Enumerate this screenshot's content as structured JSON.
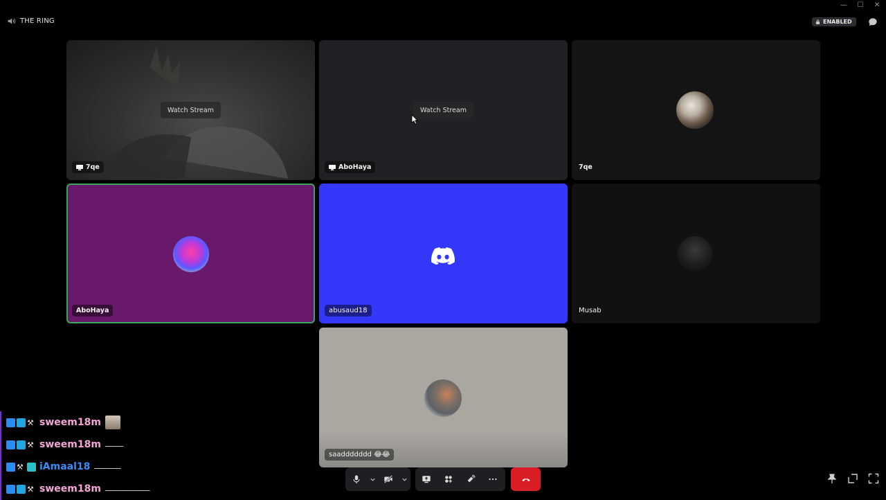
{
  "window": {
    "channel_name": "THE RING",
    "minimize": "—",
    "maximize": "☐",
    "close": "✕"
  },
  "header": {
    "status_badge": "ENABLED"
  },
  "tiles": [
    {
      "name": "7qe",
      "watch_label": "Watch Stream",
      "streaming": true
    },
    {
      "name": "AboHaya",
      "watch_label": "Watch Stream",
      "streaming": true
    },
    {
      "name": "7qe",
      "streaming": false
    },
    {
      "name": "AboHaya",
      "speaking": true,
      "bg": "#68196b"
    },
    {
      "name": "abusaud18",
      "bg": "#3338fb"
    },
    {
      "name": "Musab"
    },
    {
      "name": "saaddddddd 😂😂",
      "bg": "#aaa7a1"
    }
  ],
  "chat": [
    {
      "user": "sweem18m",
      "message": "",
      "color": "#f2a6d8"
    },
    {
      "user": "sweem18m",
      "message": "ـــــــــ",
      "color": "#f2a6d8"
    },
    {
      "user": "iAmaal18",
      "message": "ـــــــــــــ",
      "color": "#3a8ef6"
    },
    {
      "user": "sweem18m",
      "message": "ــــــــــــــــــــــ",
      "color": "#f2a6d8"
    }
  ],
  "colors": {
    "leave": "#da1e28",
    "speaking_ring": "#3ba55d",
    "discord_blurple": "#3338fb"
  },
  "controls": [
    "microphone-icon",
    "chevron-down-icon",
    "camera-off-icon",
    "chevron-down-icon",
    "screen-share-icon",
    "activities-icon",
    "soundboard-icon",
    "more-icon",
    "hang-up-icon"
  ]
}
